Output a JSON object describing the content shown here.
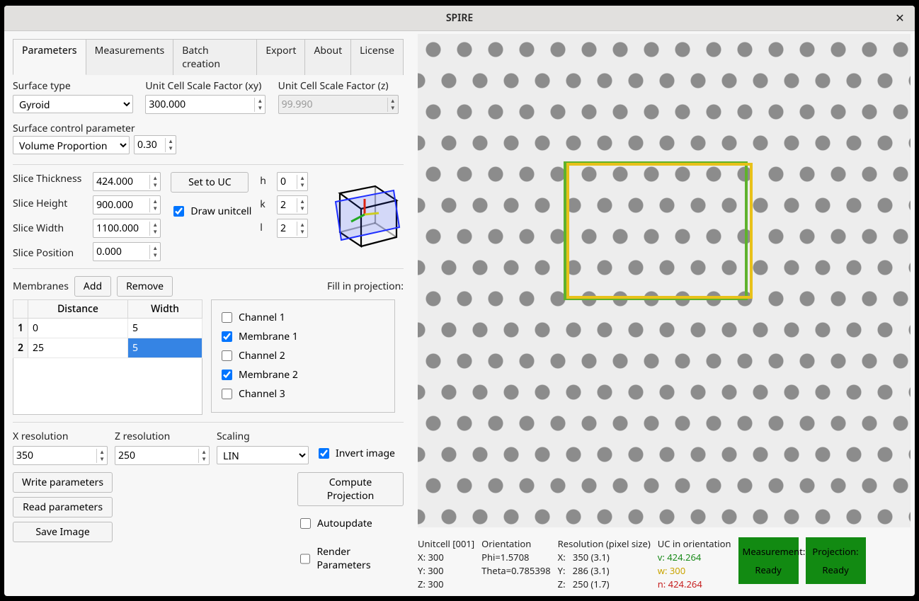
{
  "app_title": "SPIRE",
  "tabs": [
    "Parameters",
    "Measurements",
    "Batch creation",
    "Export",
    "About",
    "License"
  ],
  "surface": {
    "label_type": "Surface type",
    "type_value": "Gyroid",
    "label_xy": "Unit Cell Scale Factor (xy)",
    "xy_value": "300.000",
    "label_z": "Unit Cell Scale Factor  (z)",
    "z_value": "99.990",
    "label_ctrl": "Surface control parameter",
    "ctrl_value": "Volume Proportion",
    "ctrl_num": "0.30"
  },
  "slice": {
    "label_thick": "Slice Thickness",
    "thick": "424.000",
    "label_height": "Slice Height",
    "height": "900.000",
    "label_width": "Slice Width",
    "width": "1100.000",
    "label_pos": "Slice Position",
    "pos": "0.000",
    "set_to_uc": "Set to UC",
    "draw_uc": "Draw unitcell",
    "h_lbl": "h",
    "h": "0",
    "k_lbl": "k",
    "k": "2",
    "l_lbl": "l",
    "l": "2"
  },
  "membranes": {
    "label": "Membranes",
    "add": "Add",
    "remove": "Remove",
    "fill_label": "Fill in projection:",
    "cols": {
      "distance": "Distance",
      "width": "Width"
    },
    "rows": [
      {
        "idx": "1",
        "distance": "0",
        "width": "5"
      },
      {
        "idx": "2",
        "distance": "25",
        "width": "5"
      }
    ],
    "fill": {
      "ch1": "Channel 1",
      "m1": "Membrane 1",
      "ch2": "Channel 2",
      "m2": "Membrane 2",
      "ch3": "Channel 3"
    }
  },
  "res": {
    "xres_lbl": "X resolution",
    "xres": "350",
    "zres_lbl": "Z resolution",
    "zres": "250",
    "scaling_lbl": "Scaling",
    "scaling": "LIN",
    "invert": "Invert image"
  },
  "actions": {
    "write": "Write parameters",
    "read": "Read parameters",
    "save": "Save Image",
    "compute": "Compute Projection",
    "auto": "Autoupdate",
    "render": "Render Parameters"
  },
  "status": {
    "uc": {
      "title": "Unitcell [001]",
      "x": "X: 300",
      "y": "Y: 300",
      "z": "Z: 300"
    },
    "orient": {
      "title": "Orientation",
      "phi": "Phi=1.5708",
      "theta": "Theta=0.785398"
    },
    "resol": {
      "title": "Resolution (pixel size)",
      "x": "X:   350 (3.1)",
      "y": "Y:   286 (3.1)",
      "z": "Z:   250 (1.7)"
    },
    "ucor": {
      "title": "UC in orientation",
      "v": "v: 424.264",
      "w": "w: 300",
      "n": "n: 424.264"
    },
    "box1": {
      "l1": "Measurement:",
      "l2": "Ready"
    },
    "box2": {
      "l1": "Projection:",
      "l2": "Ready"
    }
  }
}
